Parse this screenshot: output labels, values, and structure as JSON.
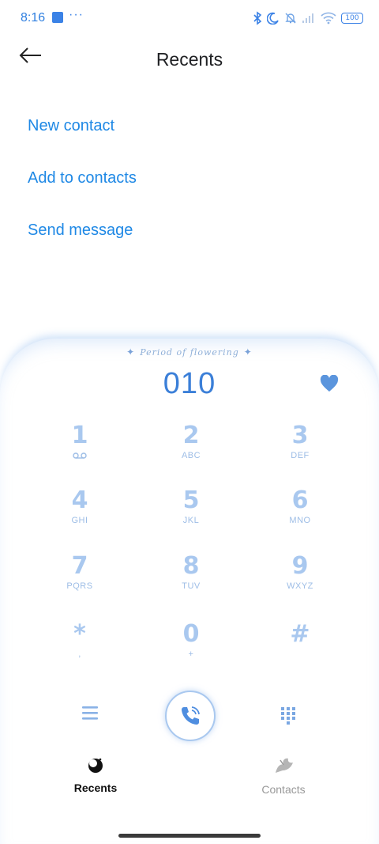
{
  "status_bar": {
    "time": "8:16",
    "overflow": "···",
    "battery": "100"
  },
  "header": {
    "title": "Recents"
  },
  "actions": [
    {
      "label": "New contact"
    },
    {
      "label": "Add to contacts"
    },
    {
      "label": "Send message"
    }
  ],
  "dialer": {
    "theme_caption": "Period of flowering",
    "number": "010",
    "keys": [
      {
        "digit": "1",
        "letters": "",
        "icon": "voicemail-icon"
      },
      {
        "digit": "2",
        "letters": "ABC"
      },
      {
        "digit": "3",
        "letters": "DEF"
      },
      {
        "digit": "4",
        "letters": "GHI"
      },
      {
        "digit": "5",
        "letters": "JKL"
      },
      {
        "digit": "6",
        "letters": "MNO"
      },
      {
        "digit": "7",
        "letters": "PQRS"
      },
      {
        "digit": "8",
        "letters": "TUV"
      },
      {
        "digit": "9",
        "letters": "WXYZ"
      },
      {
        "digit": "*",
        "letters": ","
      },
      {
        "digit": "0",
        "letters": "+"
      },
      {
        "digit": "#",
        "letters": ""
      }
    ]
  },
  "bottom_nav": {
    "tabs": [
      {
        "label": "Recents",
        "icon": "recents-icon"
      },
      {
        "label": "Contacts",
        "icon": "contacts-icon"
      }
    ]
  },
  "colors": {
    "accent": "#1e88e5",
    "key": "#a9c8ef",
    "number": "#3b7fd8"
  }
}
